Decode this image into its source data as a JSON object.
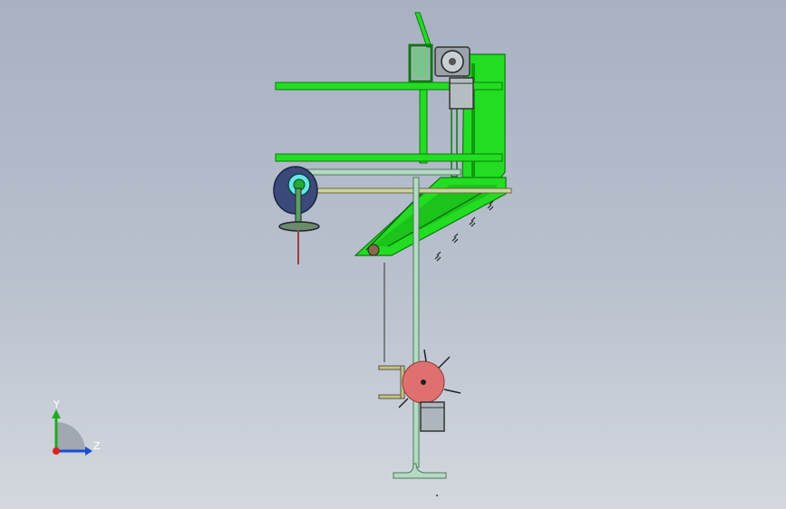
{
  "viewport": {
    "background_top": "#a7b1c2",
    "background_bottom": "#d4d8de"
  },
  "triad": {
    "y_label": "Y",
    "z_label": "Z",
    "y_color": "#22aa22",
    "z_color": "#1a4fd6",
    "x_color": "#dd2222"
  },
  "colors": {
    "frame": "#22dd22",
    "frame_dark": "#118811",
    "motor": "#9aa3aa",
    "disc": "#e07070",
    "pulley": "#3b4a7a",
    "shaft": "#b5dac4"
  }
}
